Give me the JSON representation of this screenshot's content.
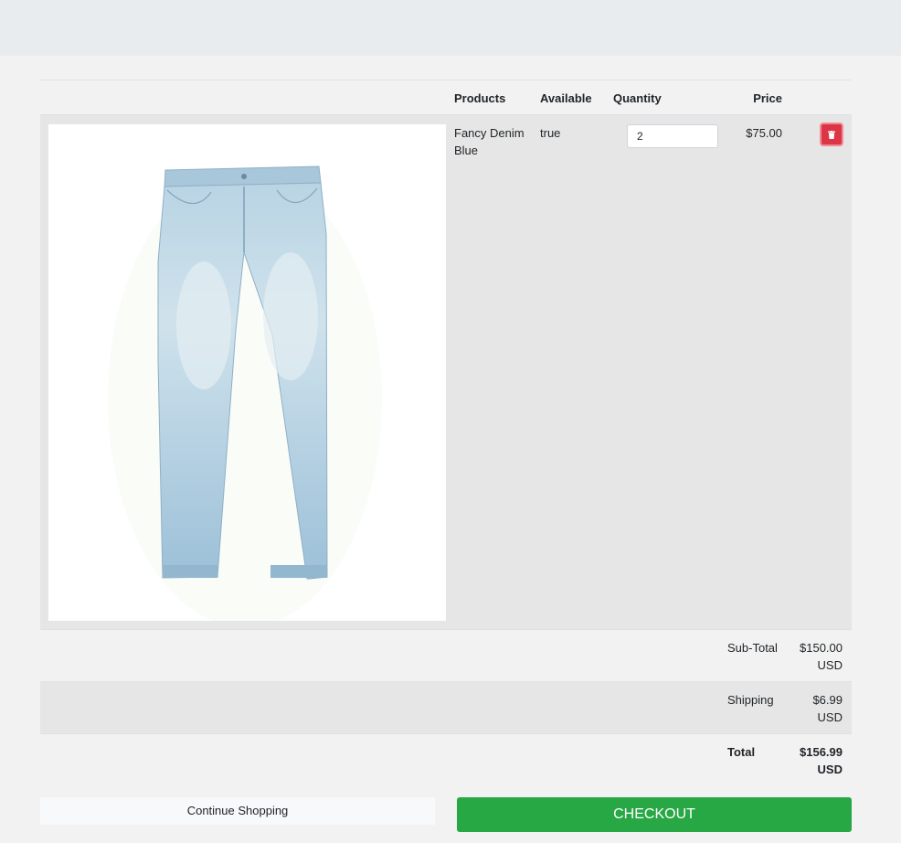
{
  "cart": {
    "headers": {
      "products": "Products",
      "available": "Available",
      "quantity": "Quantity",
      "price": "Price"
    },
    "items": [
      {
        "name": "Fancy Denim Blue",
        "available": "true",
        "quantity": "2",
        "price": "$75.00",
        "image_subject": "light-wash blue denim jeans"
      }
    ],
    "summary": {
      "subtotal_label": "Sub-Total",
      "subtotal_value": "$150.00 USD",
      "shipping_label": "Shipping",
      "shipping_value": "$6.99 USD",
      "total_label": "Total",
      "total_value": "$156.99 USD"
    }
  },
  "actions": {
    "continue_label": "Continue Shopping",
    "checkout_label": "CHECKOUT"
  },
  "icons": {
    "delete": "trash-icon"
  },
  "colors": {
    "checkout": "#28a745",
    "delete": "#dc3545",
    "row_alt": "#e6e6e6",
    "page_bg": "#f2f2f2",
    "topbar": "#e9ecef"
  }
}
